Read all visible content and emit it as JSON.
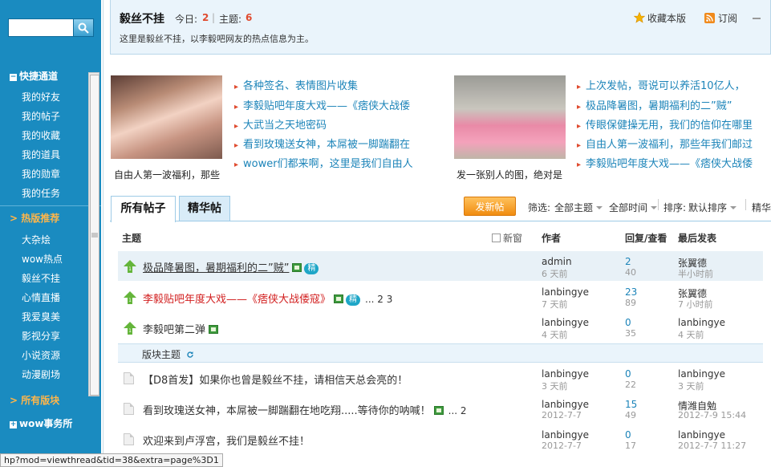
{
  "sidebar": {
    "search": {
      "placeholder": ""
    },
    "quick_nav": {
      "title": "快捷通道",
      "items": [
        "我的好友",
        "我的帖子",
        "我的收藏",
        "我的道具",
        "我的勋章",
        "我的任务"
      ]
    },
    "hot": {
      "title": "> 热版推荐",
      "items": [
        "大杂烩",
        "wow热点",
        "毅丝不挂",
        "心情直播",
        "我爱臭美",
        "影视分享",
        "小说资源",
        "动漫剧场"
      ]
    },
    "all_forums": "> 所有版块",
    "wow_affairs": "wow事务所"
  },
  "header": {
    "forum_name": "毅丝不挂",
    "today_label": "今日:",
    "today_value": "2",
    "topics_label": "主题:",
    "topics_value": "6",
    "description": "这里是毅丝不挂，以李毅吧网友的热点信息为主。",
    "favorite": "收藏本版",
    "subscribe": "订阅"
  },
  "featured": {
    "left": {
      "caption": "自由人第一波福利，那些",
      "links": [
        "各种签名、表情图片收集",
        "李毅贴吧年度大戏——《痞侠大战倭",
        "大武当之天地密码",
        "看到玫瑰送女神，本屌被一脚踹翻在",
        "wower们都来啊，这里是我们自由人"
      ]
    },
    "right": {
      "caption": "发一张别人的图，绝对是",
      "links": [
        "上次发帖，哥说可以养活10亿人，",
        "极品降暑图，暑期福利的二”贼”",
        "传眼保健操无用，我们的信仰在哪里",
        "自由人第一波福利，那些年我们邮过",
        "李毅贴吧年度大戏——《痞侠大战倭"
      ]
    }
  },
  "tabs": {
    "all": "所有帖子",
    "digest": "精华帖",
    "post_button": "发新帖",
    "filter_label": "筛选:",
    "filter_theme": "全部主题",
    "filter_time": "全部时间",
    "sort_label": "排序:",
    "sort_value": "默认排序",
    "digest_right": "精华"
  },
  "table": {
    "headers": {
      "topic": "主题",
      "new_window": "新窗",
      "author": "作者",
      "reply_view": "回复/查看",
      "last": "最后发表"
    },
    "section_label": "版块主题",
    "rows": [
      {
        "title": "极品降暑图，暑期福利的二”贼”",
        "author": "admin",
        "author_time": "6 天前",
        "replies": "2",
        "views": "40",
        "last_user": "张翼德",
        "last_time": "半小时前",
        "pages": ""
      },
      {
        "title": "李毅贴吧年度大戏——《痞侠大战倭寇》",
        "author": "lanbingye",
        "author_time": "7 天前",
        "replies": "23",
        "views": "89",
        "last_user": "张翼德",
        "last_time": "7 小时前",
        "pages": "... 2  3"
      },
      {
        "title": "李毅吧第二弹",
        "author": "lanbingye",
        "author_time": "4 天前",
        "replies": "0",
        "views": "35",
        "last_user": "lanbingye",
        "last_time": "4 天前",
        "pages": ""
      },
      {
        "title": "【D8首发】如果你也曾是毅丝不挂，请相信天总会亮的！",
        "author": "lanbingye",
        "author_time": "3 天前",
        "replies": "0",
        "views": "22",
        "last_user": "lanbingye",
        "last_time": "3 天前",
        "pages": ""
      },
      {
        "title": "看到玫瑰送女神，本屌被一脚踹翻在地吃翔.....等待你的呐喊！",
        "author": "lanbingye",
        "author_time": "2012-7-7",
        "replies": "15",
        "views": "49",
        "last_user": "情潍自勉",
        "last_time": "2012-7-9 15:44",
        "pages": "... 2"
      },
      {
        "title": "欢迎来到卢浮宫，我们是毅丝不挂！",
        "author": "lanbingye",
        "author_time": "2012-7-7",
        "replies": "0",
        "views": "17",
        "last_user": "lanbingye",
        "last_time": "2012-7-7 11:27",
        "pages": ""
      }
    ]
  },
  "status_bar": "hp?mod=viewthread&tid=38&extra=page%3D1"
}
